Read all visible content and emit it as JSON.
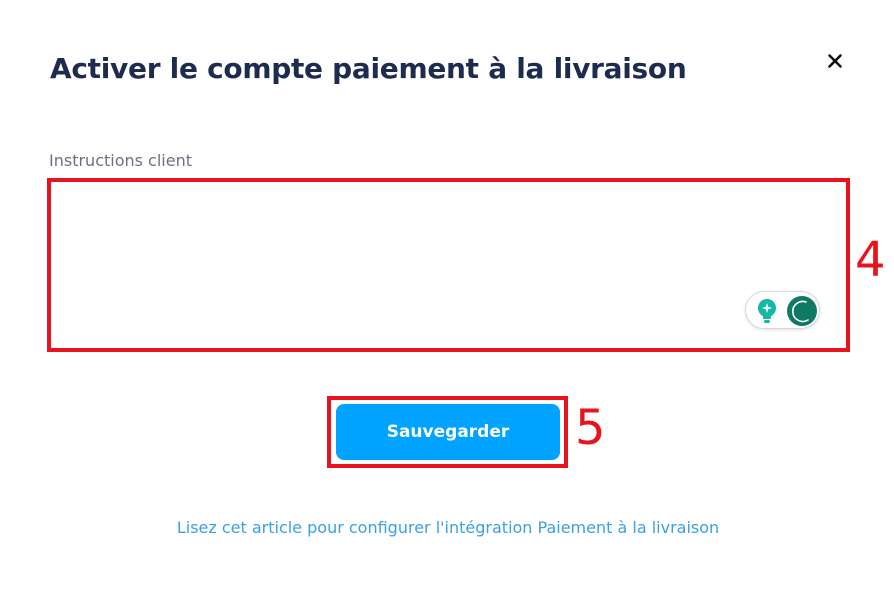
{
  "dialog": {
    "title": "Activer le compte paiement à la livraison",
    "close_icon": "close-icon"
  },
  "form": {
    "instructions_label": "Instructions client",
    "instructions_value": "",
    "instructions_placeholder": ""
  },
  "grammar_widget": {
    "icons": [
      "lightbulb-icon",
      "grammarly-icon"
    ],
    "colors": {
      "bulb": "#14b8a6",
      "grammarly": "#0f7a63"
    }
  },
  "actions": {
    "save_label": "Sauvegarder"
  },
  "help": {
    "link_text": "Lisez cet article pour configurer l'intégration Paiement à la livraison"
  },
  "annotations": {
    "textarea_number": "4",
    "save_number": "5",
    "color": "#e8131d"
  },
  "colors": {
    "title": "#1d2b4f",
    "accent": "#00a3ff",
    "link": "#3aa0e6"
  }
}
